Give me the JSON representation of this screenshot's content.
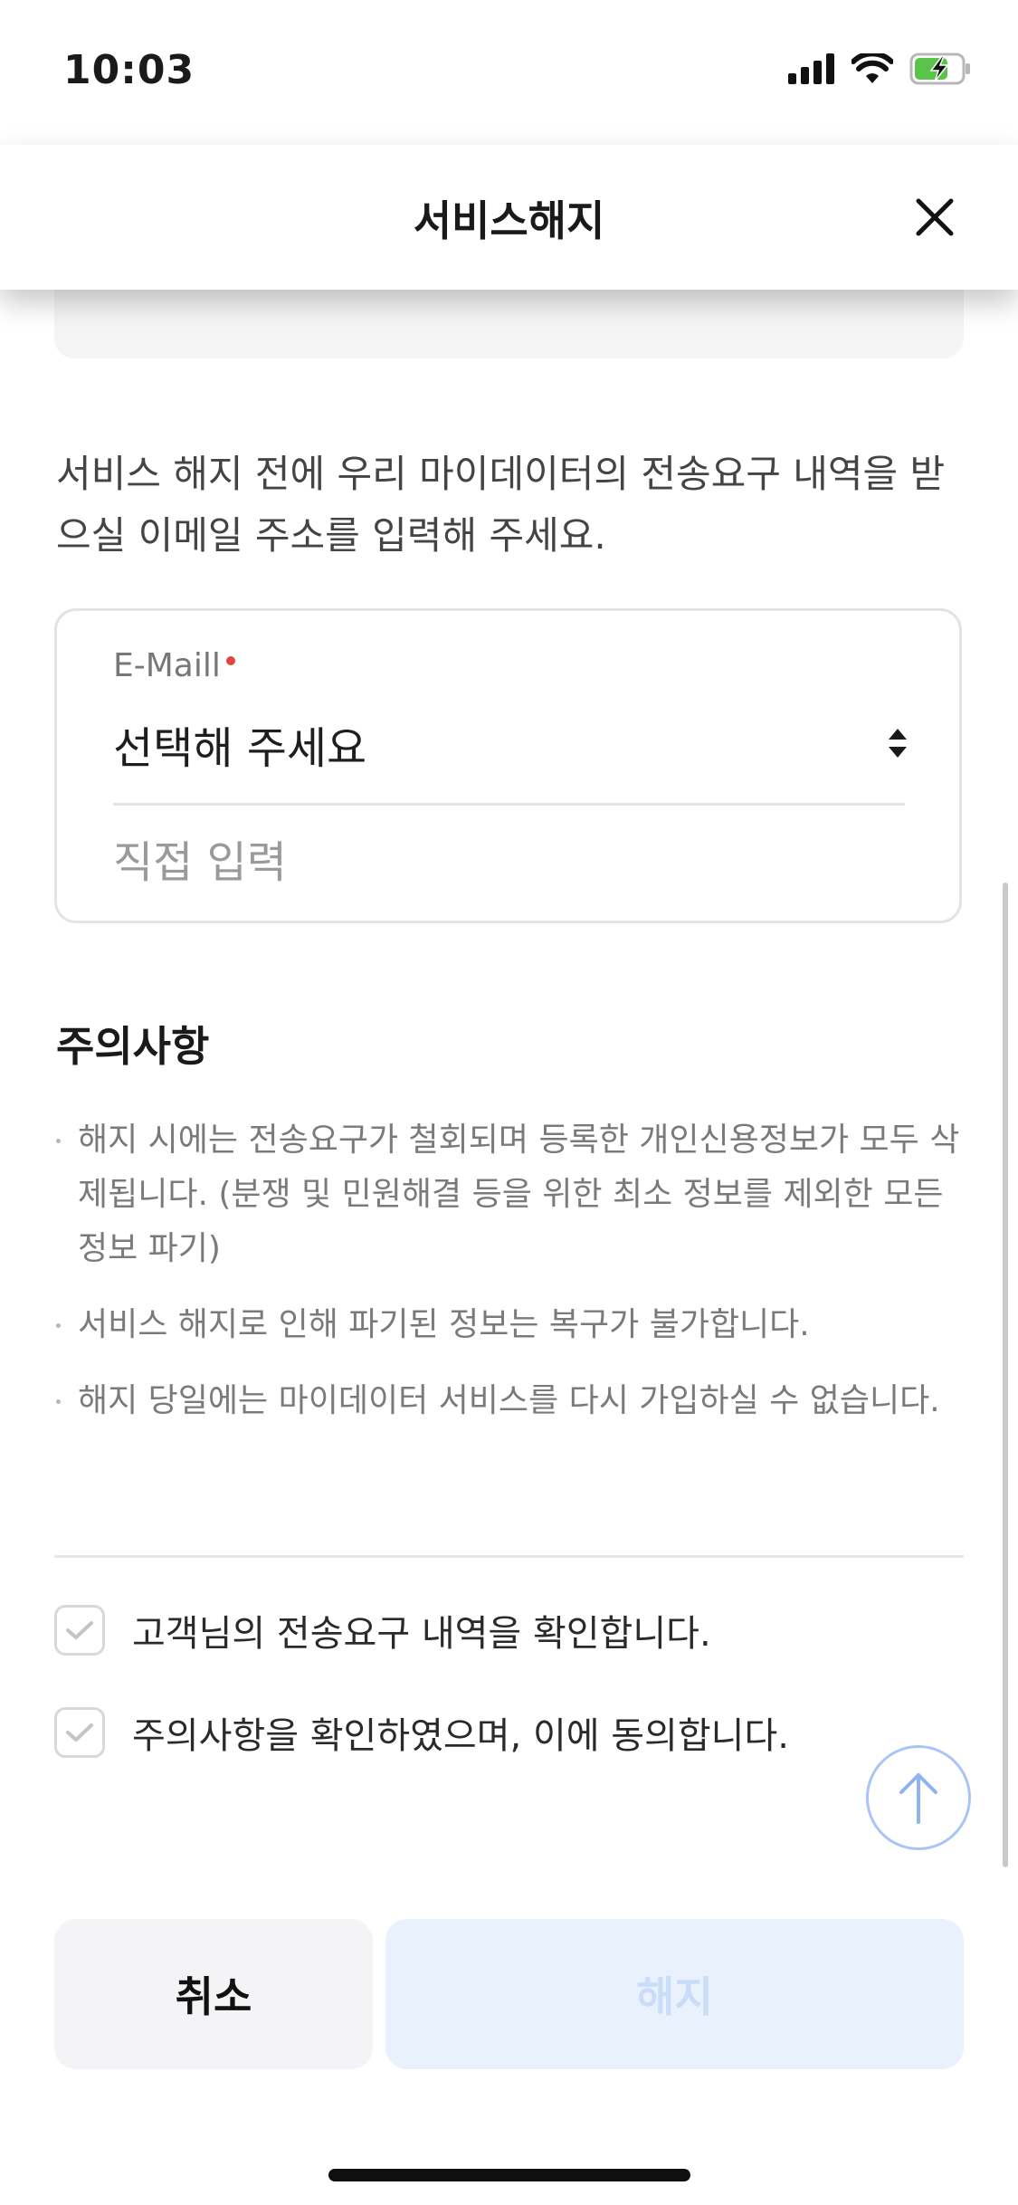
{
  "status_bar": {
    "time": "10:03"
  },
  "header": {
    "title": "서비스해지"
  },
  "intro": {
    "text": "서비스 해지 전에 우리 마이데이터의 전송요구 내역을 받으실 이메일 주소를 입력해 주세요."
  },
  "email": {
    "label": "E-Maill",
    "select_value": "선택해 주세요",
    "direct_input_placeholder": "직접 입력"
  },
  "notice": {
    "title": "주의사항",
    "items": [
      "해지 시에는 전송요구가 철회되며 등록한 개인신용정보가 모두 삭제됩니다. (분쟁 및 민원해결 등을 위한 최소 정보를 제외한 모든 정보 파기)",
      "서비스 해지로 인해 파기된 정보는 복구가 불가합니다.",
      "해지 당일에는 마이데이터 서비스를 다시 가입하실 수 없습니다."
    ]
  },
  "agreements": [
    {
      "label": "고객님의 전송요구 내역을 확인합니다."
    },
    {
      "label": "주의사항을 확인하였으며, 이에 동의합니다."
    }
  ],
  "buttons": {
    "cancel": "취소",
    "terminate": "해지"
  },
  "colors": {
    "required_dot": "#e0463e",
    "accent_light": "#a7c5f7",
    "disabled_button_bg": "#e9f1fd",
    "disabled_button_text": "#c9dcf8"
  }
}
